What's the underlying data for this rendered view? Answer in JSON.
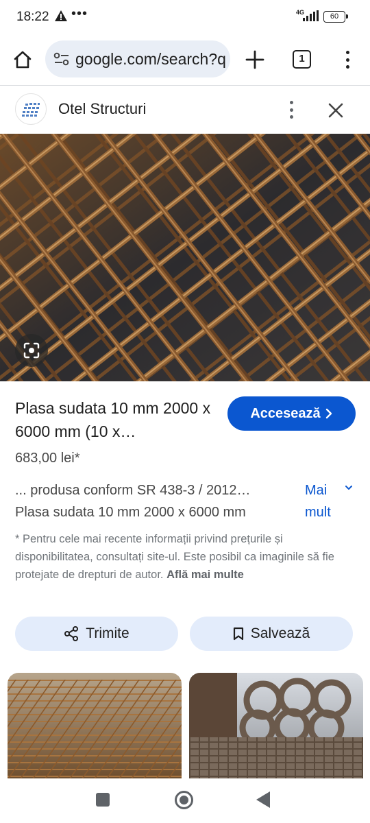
{
  "status_bar": {
    "time": "18:22",
    "network": "4G",
    "battery": "60"
  },
  "browser": {
    "url": "google.com/search?q",
    "tab_count": "1"
  },
  "panel": {
    "site_name": "Otel Structuri"
  },
  "product": {
    "title": "Plasa sudata 10 mm 2000 x 6000 mm (10 x…",
    "visit_label": "Accesează",
    "price": "683,00 lei*",
    "description_line1": "... produsa conform SR 438-3 / 2012…",
    "description_line2": "Plasa sudata 10 mm 2000 x 6000 mm",
    "more_label_1": "Mai",
    "more_label_2": "mult",
    "disclaimer": "* Pentru cele mai recente informații privind prețurile și disponibilitatea, consultați site-ul. Este posibil ca imaginile să fie protejate de drepturi de autor.",
    "learn_more": "Află mai multe",
    "share_label": "Trimite",
    "save_label": "Salvează"
  },
  "icons": {
    "home": "home-icon",
    "tune": "tune-icon",
    "new_tab": "plus-icon",
    "menu": "more-vert-icon",
    "close": "close-icon",
    "lens": "lens-icon",
    "share": "share-icon",
    "bookmark": "bookmark-icon"
  },
  "colors": {
    "accent": "#0b57d0",
    "omnibox": "#e9eef6",
    "chip": "#e3ecfb"
  }
}
